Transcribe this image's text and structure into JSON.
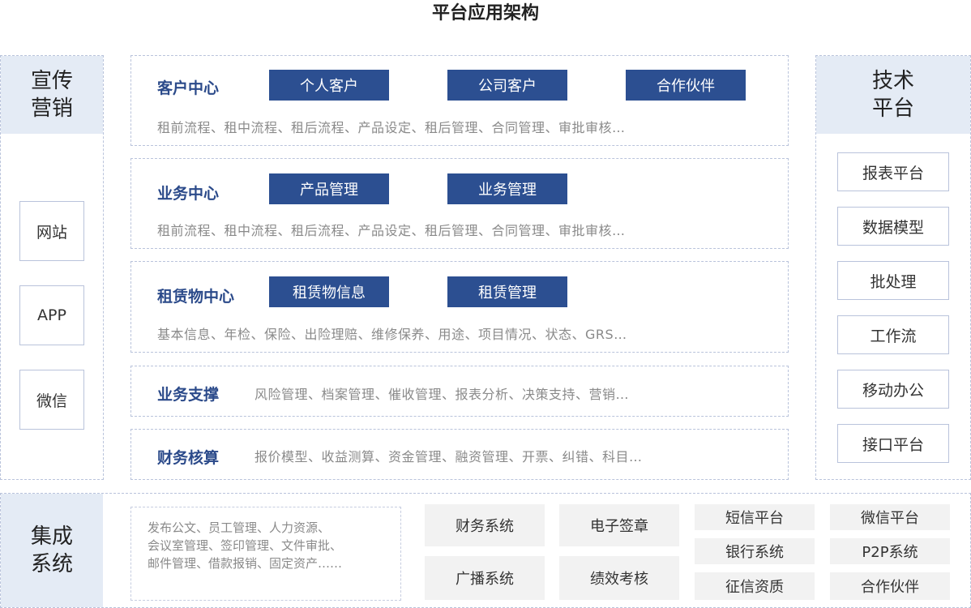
{
  "title": "平台应用架构",
  "left": {
    "head": [
      "宣传",
      "营销"
    ],
    "items": [
      "网站",
      "APP",
      "微信"
    ]
  },
  "right": {
    "head": [
      "技术",
      "平台"
    ],
    "items": [
      "报表平台",
      "数据模型",
      "批处理",
      "工作流",
      "移动办公",
      "接口平台"
    ]
  },
  "panels": [
    {
      "title": "客户中心",
      "buttons": [
        "个人客户",
        "公司客户",
        "合作伙伴"
      ],
      "desc": "租前流程、租中流程、租后流程、产品设定、租后管理、合同管理、审批审核…"
    },
    {
      "title": "业务中心",
      "buttons": [
        "产品管理",
        "业务管理"
      ],
      "desc": "租前流程、租中流程、租后流程、产品设定、租后管理、合同管理、审批审核…"
    },
    {
      "title": "租赁物中心",
      "buttons": [
        "租赁物信息",
        "租赁管理"
      ],
      "desc": "基本信息、年检、保险、出险理赔、维修保养、用途、项目情况、状态、GRS…"
    },
    {
      "title": "业务支撑",
      "desc": "风险管理、档案管理、催收管理、报表分析、决策支持、营销…"
    },
    {
      "title": "财务核算",
      "desc": "报价模型、收益测算、资金管理、融资管理、开票、纠错、科目…"
    }
  ],
  "bottom": {
    "head": [
      "集成",
      "系统"
    ],
    "misc": [
      "发布公文、员工管理、人力资源、",
      "会议室管理、签印管理、文件审批、",
      "邮件管理、借款报销、固定资产……"
    ],
    "big": [
      "财务系统",
      "电子签章",
      "广播系统",
      "绩效考核"
    ],
    "small": [
      "短信平台",
      "微信平台",
      "银行系统",
      "P2P系统",
      "征信资质",
      "合作伙伴"
    ]
  }
}
